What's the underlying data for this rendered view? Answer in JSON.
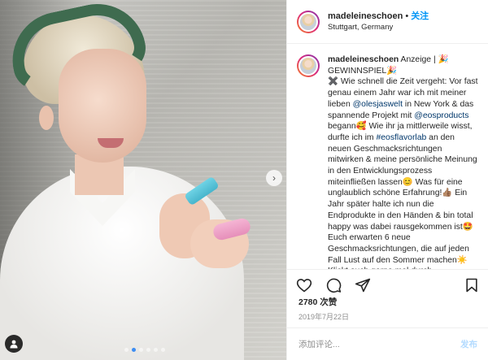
{
  "header": {
    "username": "madeleineschoen",
    "separator": "•",
    "follow_label": "关注",
    "location": "Stuttgart, Germany"
  },
  "caption": {
    "username": "madeleineschoen",
    "segments": [
      {
        "text": "Anzeige | 🎉 GEWINNSPIEL🎉",
        "type": "text"
      },
      {
        "text": "✖️ Wie schnell die Zeit vergeht: Vor fast genau einem Jahr war ich mit meiner lieben ",
        "type": "text"
      },
      {
        "text": "@olesjaswelt",
        "type": "mention"
      },
      {
        "text": " in New York & das spannende Projekt mit ",
        "type": "text"
      },
      {
        "text": "@eosproducts",
        "type": "mention"
      },
      {
        "text": " begann🥰 Wie ihr ja mittlerweile wisst, durfte ich im ",
        "type": "text"
      },
      {
        "text": "#eosflavorlab",
        "type": "mention"
      },
      {
        "text": " an den neuen Geschmacksrichtungen mitwirken & meine persönliche Meinung in den Entwicklungsprozess miteinfließen lassen😊 Was für eine unglaublich schöne Erfahrung!👍🏽 Ein Jahr später halte ich nun die Endprodukte in den Händen & bin total happy was dabei rausgekommen ist🤩 Euch erwarten 6 neue Geschmacksrichtungen, die auf jeden Fall Lust auf den Sommer machen☀️ Klickt euch gerne mal durch",
        "type": "text"
      }
    ]
  },
  "stats": {
    "likes": "2780 次赞",
    "date": "2019年7月22日"
  },
  "comment": {
    "placeholder": "添加评论...",
    "post_label": "发布"
  },
  "photo": {
    "slide_count": 6,
    "active_slide": 1,
    "next_arrow": "›"
  },
  "icons": [
    "heart-icon",
    "comment-icon",
    "share-icon",
    "bookmark-icon",
    "user-tag-icon"
  ],
  "colors": {
    "link": "#0095f6",
    "mention": "#00376b",
    "slide_active": "#3d8ef2"
  }
}
